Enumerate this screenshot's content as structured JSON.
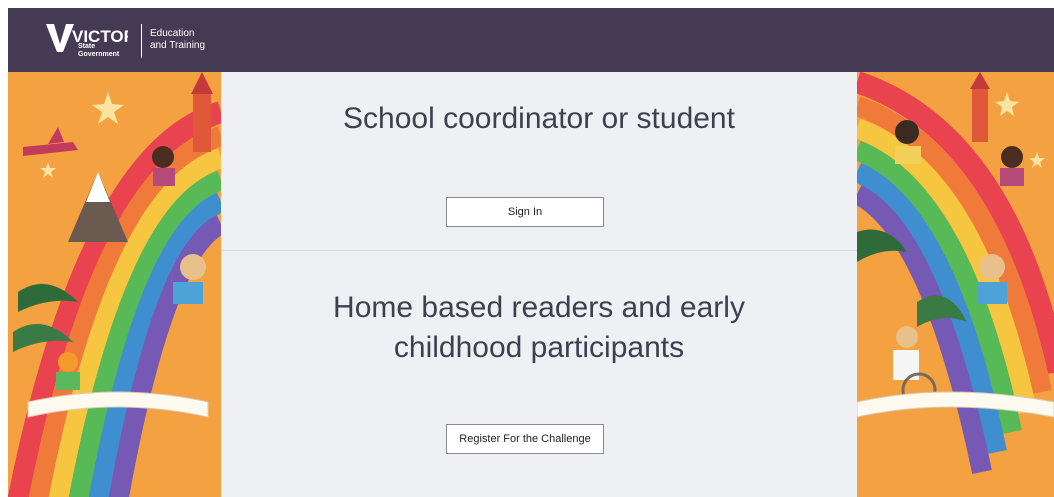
{
  "header": {
    "logo_wordmark": "VICTORIA",
    "logo_sub_line1": "State",
    "logo_sub_line2": "Government",
    "dept_line1": "Education",
    "dept_line2": "and Training",
    "background_color": "#453a54"
  },
  "sections": [
    {
      "heading": "School coordinator or student",
      "button_label": "Sign In"
    },
    {
      "heading": "Home based readers and early childhood participants",
      "button_label": "Register For the Challenge"
    }
  ],
  "colors": {
    "main_background": "#eff0f4",
    "art_background": "#f4a142"
  }
}
